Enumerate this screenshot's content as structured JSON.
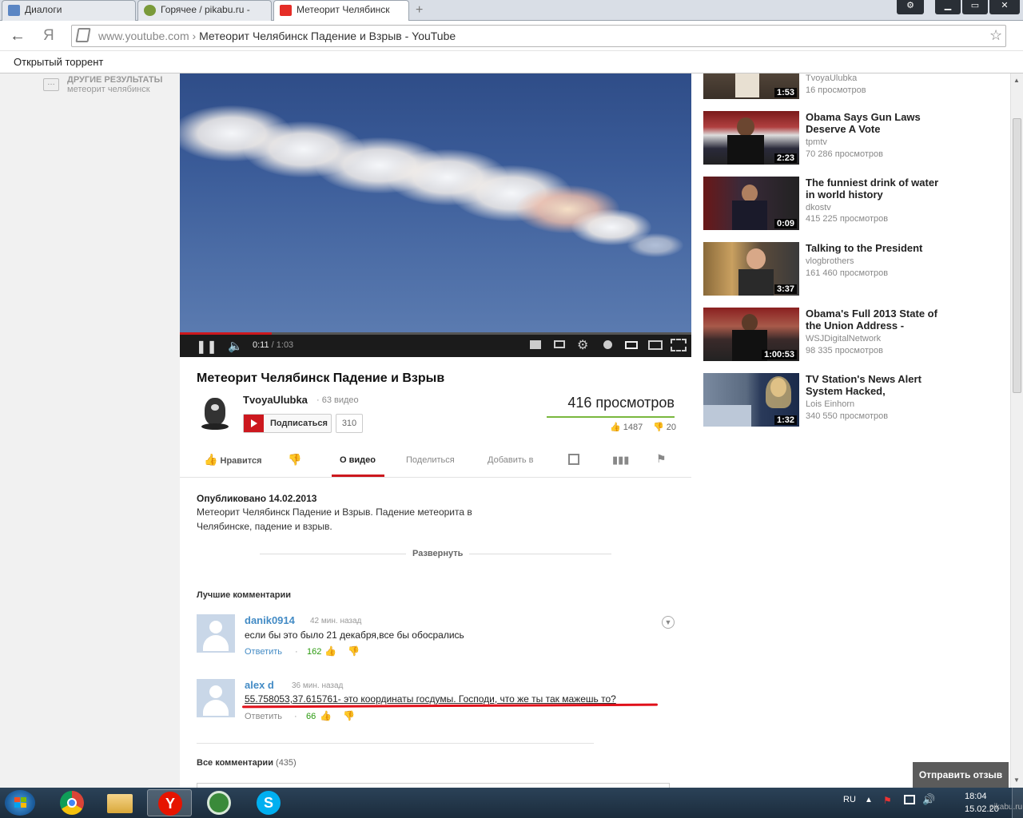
{
  "tabs": [
    {
      "label": "Диалоги"
    },
    {
      "label": "Горячее / pikabu.ru -"
    },
    {
      "label": "Метеорит Челябинск"
    }
  ],
  "address": {
    "domain": "www.youtube.com",
    "sep": "›",
    "title": "Метеорит Челябинск Падение и Взрыв - YouTube"
  },
  "bookmark": "Открытый торрент",
  "left_panel": {
    "title": "ДРУГИЕ РЕЗУЛЬТАТЫ",
    "sub": "метеорит челябинск"
  },
  "player": {
    "time": "0:11",
    "duration": "/ 1:03",
    "progress": 0.18
  },
  "video": {
    "title": "Метеорит Челябинск Падение и Взрыв",
    "channel": "TvoyaUlubka",
    "video_count": "· 63 видео",
    "subscribe": "Подписаться",
    "subscribers": "310",
    "views": "416 просмотров",
    "likes": "1487",
    "dislikes": "20"
  },
  "actions": {
    "like": "Нравится",
    "about": "О видео",
    "share": "Поделиться",
    "add": "Добавить в"
  },
  "description": {
    "published": "Опубликовано 14.02.2013",
    "text1": "Метеорит Челябинск Падение и Взрыв. Падение метеорита в",
    "text2": "Челябинске, падение и взрыв.",
    "expand": "Развернуть"
  },
  "comments": {
    "best_label": "Лучшие комментарии",
    "items": [
      {
        "user": "danik0914",
        "time": "42 мин. назад",
        "text": "если бы это было 21 декабря,все бы обосрались",
        "reply": "Ответить",
        "likes": "162"
      },
      {
        "user": "alex d",
        "time": "36 мин. назад",
        "text": "55.758053,37.615761- это координаты госдумы. Господи, что же ты так мажешь то?",
        "reply": "Ответить",
        "likes": "66"
      }
    ],
    "all_label": "Все комментарии",
    "all_count": "(435)"
  },
  "related": [
    {
      "title": "",
      "channel": "TvoyaUlubka",
      "views": "16 просмотров",
      "duration": "1:53"
    },
    {
      "title": "Obama Says Gun Laws Deserve A Vote",
      "channel": "tpmtv",
      "views": "70 286 просмотров",
      "duration": "2:23"
    },
    {
      "title": "The funniest drink of water in world history",
      "channel": "dkostv",
      "views": "415 225 просмотров",
      "duration": "0:09"
    },
    {
      "title": "Talking to the President",
      "channel": "vlogbrothers",
      "views": "161 460 просмотров",
      "duration": "3:37"
    },
    {
      "title": "Obama's Full 2013 State of the Union Address -",
      "channel": "WSJDigitalNetwork",
      "views": "98 335 просмотров",
      "duration": "1:00:53"
    },
    {
      "title": "TV Station's News Alert System Hacked,",
      "channel": "Lois Einhorn",
      "views": "340 550 просмотров",
      "duration": "1:32"
    }
  ],
  "feedback": "Отправить отзыв",
  "tray": {
    "lang": "RU",
    "time": "18:04",
    "date": "15.02.20",
    "watermark": "pikabu.ru"
  },
  "colors": {
    "accent_red": "#cc181e",
    "link_blue": "#438bc5",
    "like_green": "#2b9a0f",
    "views_bar": "#79b83e"
  }
}
